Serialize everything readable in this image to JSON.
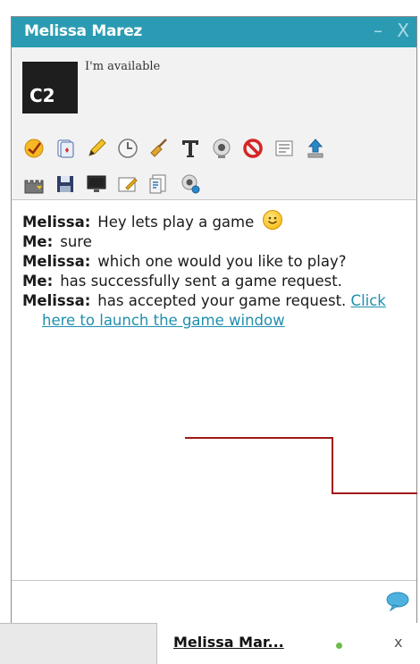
{
  "window": {
    "title": "Melissa Marez",
    "minimize_label": "–",
    "close_label": "X"
  },
  "profile": {
    "avatar_text": "C2",
    "status": "I'm available"
  },
  "toolbar": {
    "row1": [
      "emoticon-icon",
      "card-game-icon",
      "pencil-icon",
      "clock-icon",
      "broom-icon",
      "text-format-icon",
      "webcam-icon",
      "block-icon",
      "list-icon",
      "upload-icon"
    ],
    "row2": [
      "castle-game-icon",
      "save-icon",
      "monitor-icon",
      "whiteboard-icon",
      "document-icon",
      "webcam-search-icon"
    ]
  },
  "messages": [
    {
      "sender": "Melissa:",
      "text": "Hey lets play a game",
      "emoticon": "smile"
    },
    {
      "sender": "Me:",
      "text": "sure"
    },
    {
      "sender": "Melissa:",
      "text": "which one would you like to play?"
    },
    {
      "sender": "Me:",
      "text": "has successfully sent a game request."
    },
    {
      "sender": "Melissa:",
      "text": "has accepted your game request.",
      "link": "Click here to launch the game window"
    }
  ],
  "input": {
    "value": "",
    "placeholder": ""
  },
  "taskbar": {
    "tab_label": "Melissa Mar...",
    "close_label": "x"
  },
  "colors": {
    "titlebar": "#2b9bb3",
    "link": "#1f8fae",
    "annotation": "#a01818",
    "online": "#6dbb4a"
  }
}
